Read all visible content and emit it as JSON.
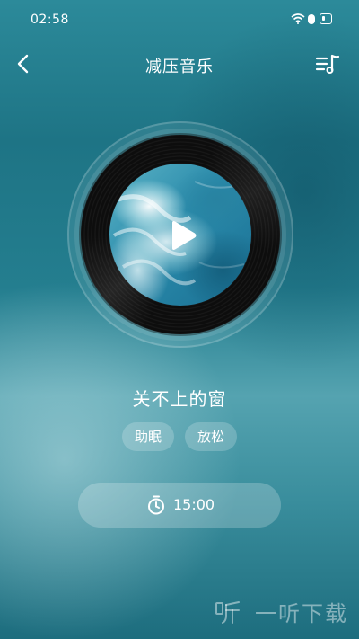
{
  "status_bar": {
    "time": "02:58",
    "icons": [
      "wifi-icon",
      "alarm-icon",
      "battery-icon"
    ]
  },
  "header": {
    "title": "减压音乐",
    "back_icon": "chevron-left-icon",
    "playlist_icon": "playlist-music-icon"
  },
  "player": {
    "cover_icon": "ocean-waves-cover",
    "play_icon": "play-icon",
    "track_title": "关不上的窗",
    "tags": [
      "助眠",
      "放松"
    ]
  },
  "timer": {
    "icon": "stopwatch-icon",
    "value": "15:00"
  },
  "watermark": {
    "text": "一听下载"
  },
  "colors": {
    "background_top": "#2c8a9a",
    "background_bottom": "#1d6d7e",
    "text": "#ffffff"
  }
}
